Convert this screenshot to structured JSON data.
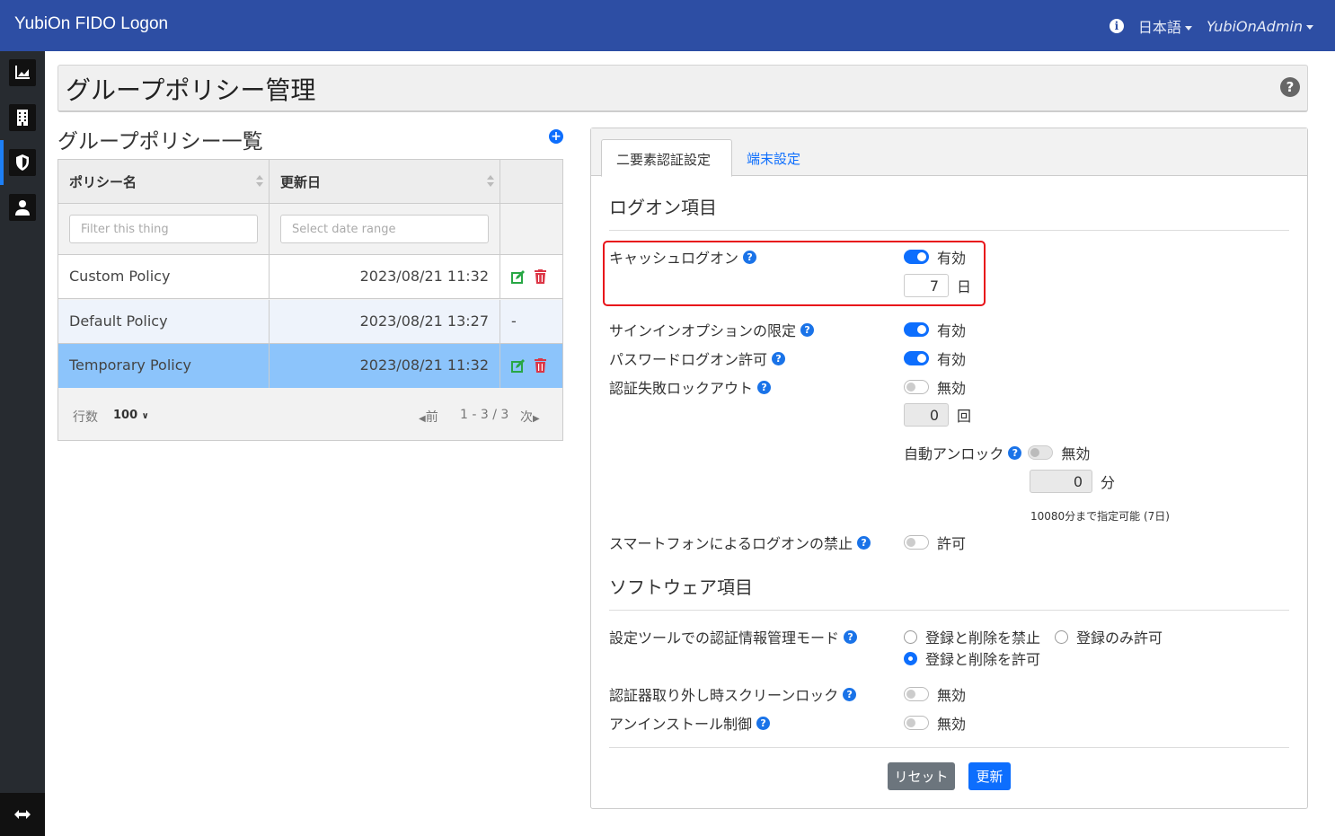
{
  "app": {
    "title": "YubiOn FIDO Logon"
  },
  "navbar": {
    "language": "日本語",
    "user": "YubiOnAdmin"
  },
  "page": {
    "title": "グループポリシー管理"
  },
  "policy_list": {
    "title": "グループポリシー一覧",
    "columns": {
      "name": "ポリシー名",
      "updated": "更新日"
    },
    "filters": {
      "name_placeholder": "Filter this thing",
      "date_placeholder": "Select date range"
    },
    "rows": [
      {
        "name": "Custom Policy",
        "updated": "2023/08/21 11:32",
        "actions": "edit-delete"
      },
      {
        "name": "Default Policy",
        "updated": "2023/08/21 13:27",
        "actions": "-"
      },
      {
        "name": "Temporary Policy",
        "updated": "2023/08/21 11:32",
        "actions": "edit-delete"
      }
    ],
    "footer": {
      "rows_label": "行数",
      "rows_value": "100",
      "prev": "前",
      "range": "1 - 3 / 3",
      "next": "次"
    }
  },
  "tabs": [
    {
      "label": "二要素認証設定",
      "active": true
    },
    {
      "label": "端末設定",
      "active": false
    }
  ],
  "logon": {
    "section_title": "ログオン項目",
    "cache_logon": {
      "label": "キャッシュログオン",
      "state": "有効",
      "enabled": true,
      "days": "7",
      "unit": "日"
    },
    "signin_option": {
      "label": "サインインオプションの限定",
      "state": "有効",
      "enabled": true
    },
    "password_logon": {
      "label": "パスワードログオン許可",
      "state": "有効",
      "enabled": true
    },
    "lockout": {
      "label": "認証失敗ロックアウト",
      "state": "無効",
      "enabled": false,
      "count": "0",
      "count_unit": "回",
      "auto_unlock": {
        "label": "自動アンロック",
        "state": "無効",
        "minutes": "0",
        "unit": "分",
        "hint": "10080分まで指定可能 (7日)"
      }
    },
    "smartphone": {
      "label": "スマートフォンによるログオンの禁止",
      "state": "許可",
      "enabled": false
    }
  },
  "software": {
    "section_title": "ソフトウェア項目",
    "cred_mode": {
      "label": "設定ツールでの認証情報管理モード",
      "options": [
        "登録と削除を禁止",
        "登録のみ許可",
        "登録と削除を許可"
      ],
      "selected": "登録と削除を許可"
    },
    "screen_lock": {
      "label": "認証器取り外し時スクリーンロック",
      "state": "無効"
    },
    "uninstall": {
      "label": "アンインストール制御",
      "state": "無効"
    }
  },
  "buttons": {
    "reset": "リセット",
    "update": "更新"
  },
  "colors": {
    "navbar": "#2d4ea4",
    "sidebar": "#272b30",
    "accent": "#0d6efd",
    "selected_row": "#8cc4fb",
    "highlight": "#e8131a",
    "reset_btn": "#6c757d"
  }
}
